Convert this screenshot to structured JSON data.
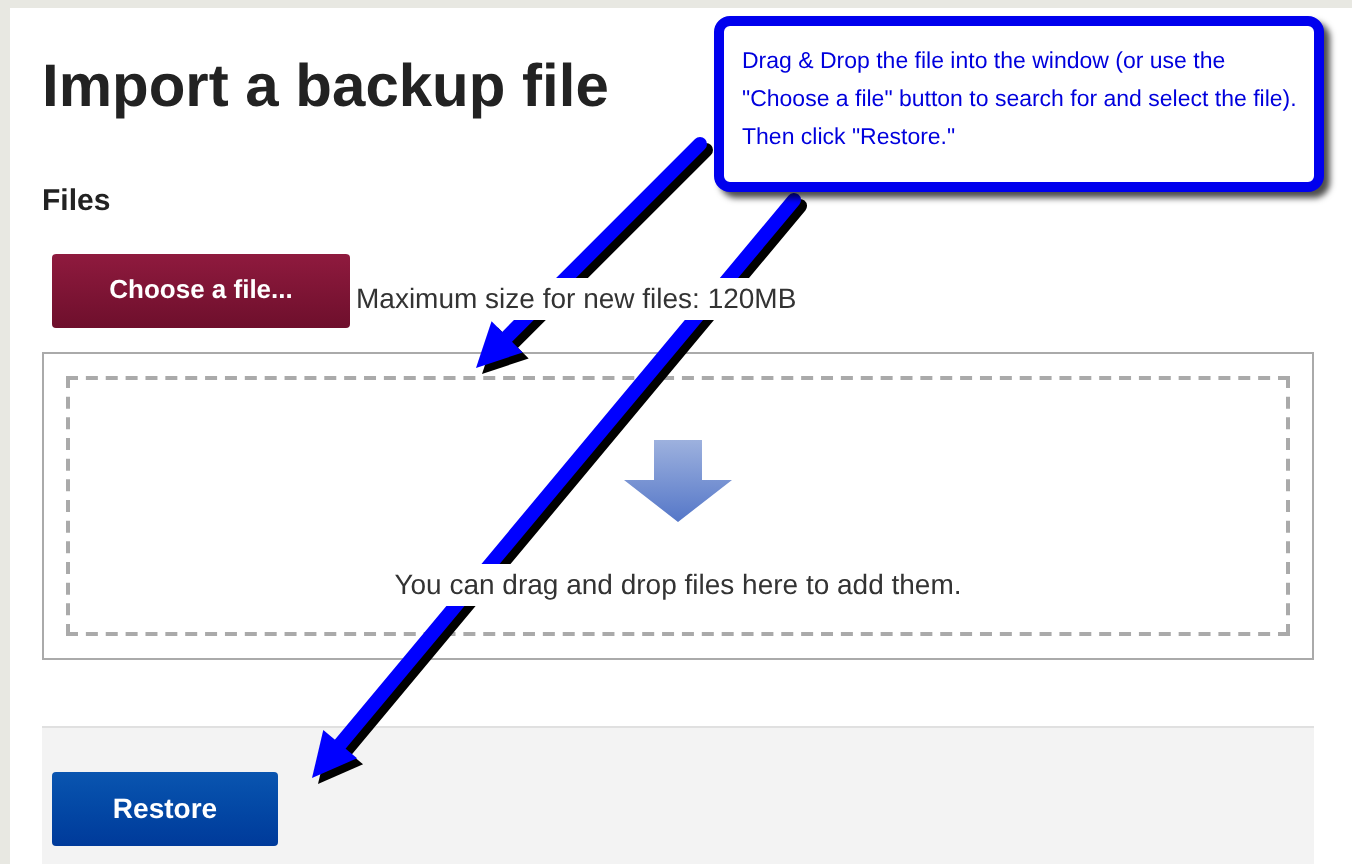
{
  "page": {
    "title": "Import a backup file"
  },
  "files_section": {
    "label": "Files",
    "choose_button": "Choose a file...",
    "max_size_note": "Maximum size for new files: 120MB"
  },
  "dropzone": {
    "message": "You can drag and drop files here to add them."
  },
  "footer": {
    "restore_button": "Restore"
  },
  "callout": {
    "text": "Drag & Drop the file into the window (or use the \"Choose a file\" button to search for and select the file). Then click \"Restore.\""
  }
}
